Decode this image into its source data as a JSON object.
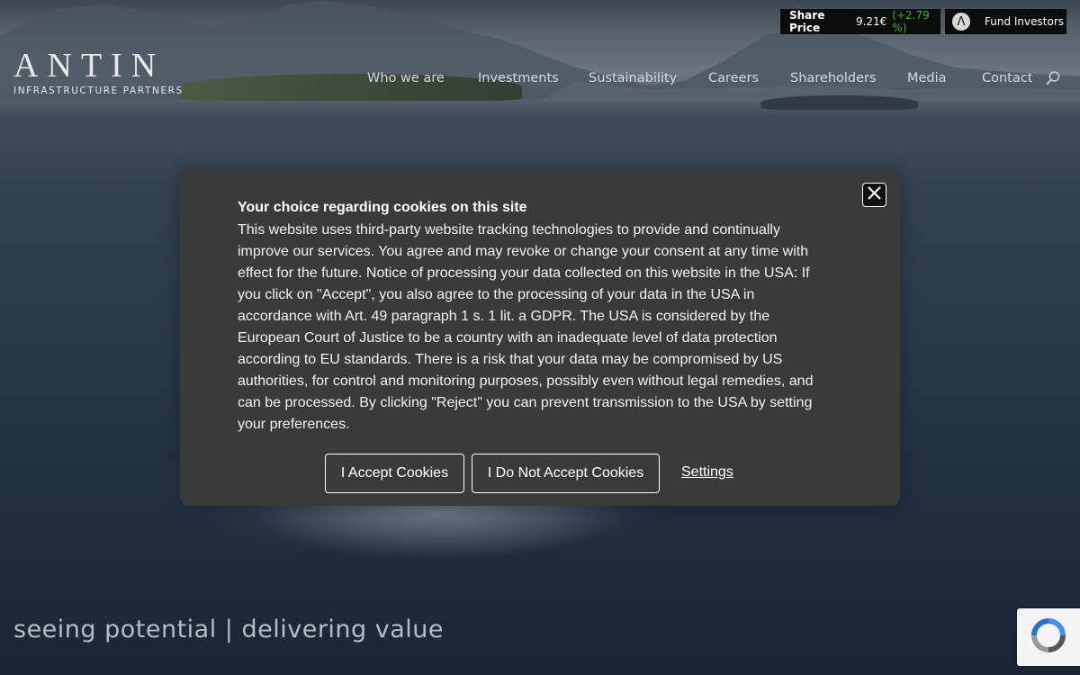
{
  "top_bar": {
    "share_label": "Share Price",
    "share_value": "9.21€",
    "share_change": "(+2.79 %)",
    "fund_logo_glyph": "Λ",
    "fund_label": "Fund Investors"
  },
  "logo": {
    "name": "ANTIN",
    "subtitle": "INFRASTRUCTURE PARTNERS"
  },
  "nav": {
    "items": [
      {
        "label": "Who we are"
      },
      {
        "label": "Investments"
      },
      {
        "label": "Sustainability"
      },
      {
        "label": "Careers"
      },
      {
        "label": "Shareholders"
      },
      {
        "label": "Media"
      },
      {
        "label": "Contact"
      }
    ],
    "search_icon": "search-icon"
  },
  "cookie_dialog": {
    "title": "Your choice regarding cookies on this site",
    "body": "This website uses third-party website tracking technologies to provide and continually improve our services. You agree and may revoke or change your consent at any time with effect for the future. Notice of processing your data collected on this website in the USA: If you click on \"Accept\", you also agree to the processing of your data in the USA in accordance with Art. 49 paragraph 1 s. 1 lit. a GDPR. The USA is considered by the European Court of Justice to be a country with an inadequate level of data protection according to EU standards. There is a risk that your data may be compromised by US authorities, for control and monitoring purposes, possibly even without legal remedies, and can be processed. By clicking \"Reject\" you can prevent transmission to the USA by setting your preferences.",
    "accept_label": "I Accept Cookies",
    "reject_label": "I Do Not Accept Cookies",
    "settings_label": "Settings",
    "close_icon": "close-icon"
  },
  "hero": {
    "tagline": "seeing potential | delivering value"
  },
  "colors": {
    "dialog_bg": "#3a3a3a",
    "share_change": "#3bb03b",
    "topbar_bg": "#0c0c0c"
  }
}
